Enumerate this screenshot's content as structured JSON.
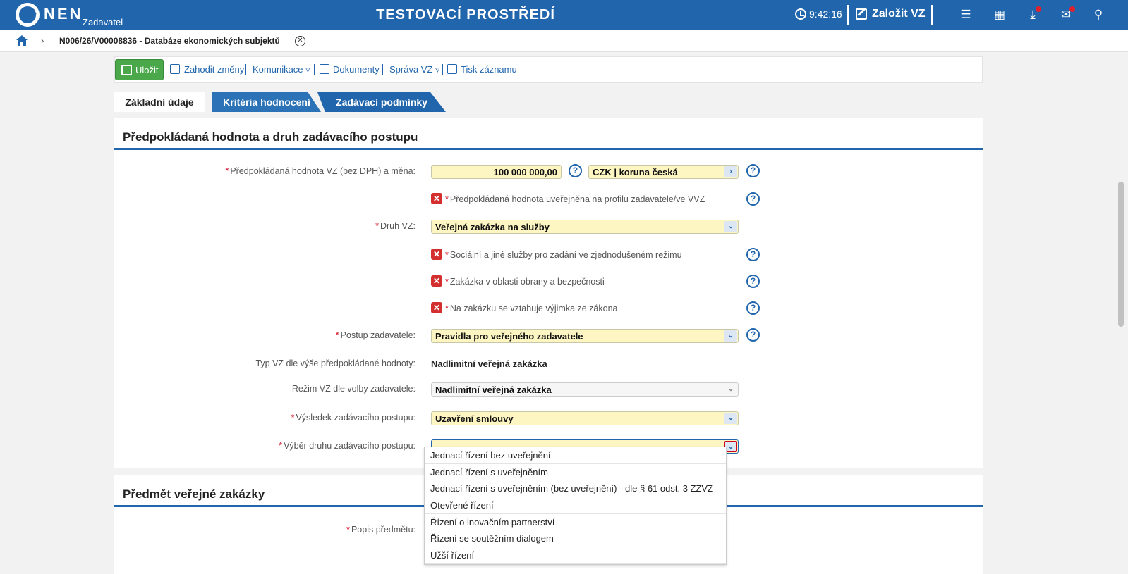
{
  "header": {
    "brand": "NEN",
    "brand_sub": "Zadavatel",
    "environment": "TESTOVACÍ PROSTŘEDÍ",
    "time": "9:42:16",
    "new_vz_label": "Založit VZ"
  },
  "breadcrumb": {
    "current": "N006/26/V00008836 - Databáze ekonomických subjektů"
  },
  "toolbar": {
    "save_label": "Uložit",
    "discard_label": "Zahodit změny",
    "communication_label": "Komunikace ▿",
    "documents_label": "Dokumenty",
    "manage_label": "Správa VZ ▿",
    "print_label": "Tisk záznamu"
  },
  "tabs": [
    {
      "label": "Základní údaje"
    },
    {
      "label": "Kritéria hodnocení"
    },
    {
      "label": "Zadávací podmínky"
    }
  ],
  "section1": {
    "title": "Předpokládaná hodnota a druh zadávacího postupu",
    "value_label": "Předpokládaná hodnota VZ (bez DPH) a měna:",
    "value": "100 000 000,00",
    "currency": "CZK | koruna česká",
    "published_label": "Předpokládaná hodnota uveřejněna na profilu zadavatele/ve VVZ",
    "type_label": "Druh VZ:",
    "type_value": "Veřejná zakázka na služby",
    "social_label": "Sociální a jiné služby pro zadání ve zjednodušeném režimu",
    "defense_label": "Zakázka v oblasti obrany a bezpečnosti",
    "exception_label": "Na zakázku se vztahuje výjimka ze zákona",
    "procedure_label": "Postup zadavatele:",
    "procedure_value": "Pravidla pro veřejného zadavatele",
    "vz_type_label": "Typ VZ dle výše předpokládané hodnoty:",
    "vz_type_value": "Nadlimitní veřejná zakázka",
    "regime_label": "Režim VZ dle volby zadavatele:",
    "regime_value": "Nadlimitní veřejná zakázka",
    "result_label": "Výsledek zadávacího postupu:",
    "result_value": "Uzavření smlouvy",
    "choice_label": "Výběr druhu zadávacího postupu:",
    "choice_value": ""
  },
  "dropdown_options": [
    "Jednací řízení bez uveřejnění",
    "Jednací řízení s uveřejněním",
    "Jednací řízení s uveřejněním (bez uveřejnění) - dle § 61 odst. 3 ZZVZ",
    "Otevřené řízení",
    "Řízení o inovačním partnerství",
    "Řízení se soutěžním dialogem",
    "Užší řízení"
  ],
  "section2": {
    "title": "Předmět veřejné zakázky",
    "subject_label": "Popis předmětu:"
  },
  "colors": {
    "primary": "#2166ad",
    "save_green": "#4aa84b",
    "field_yellow": "#fdf6c3",
    "required_red": "#d0021b"
  }
}
